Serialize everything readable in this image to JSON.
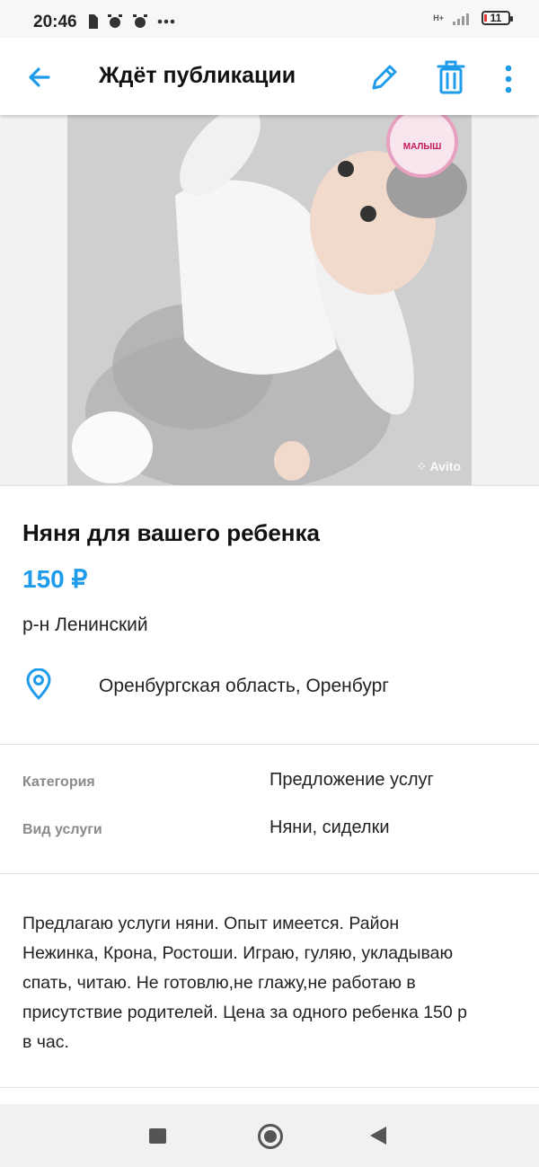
{
  "status_bar": {
    "time": "20:46",
    "network": "H+",
    "battery": "11",
    "icons": [
      "sim-icon",
      "alarm-icon",
      "alarm-icon",
      "more-dots-icon",
      "signal-icon",
      "battery-icon"
    ]
  },
  "app_bar": {
    "title": "Ждёт публикации",
    "icons": [
      "back-arrow-icon",
      "edit-pencil-icon",
      "trash-icon",
      "more-vert-icon"
    ],
    "accent_color": "#1e9bea"
  },
  "photo": {
    "watermark": "Avito",
    "badge_text": "МАЛЫШ"
  },
  "listing": {
    "title": "Няня для вашего ребенка",
    "price": "150 ₽",
    "district": "р-н Ленинский",
    "location": "Оренбургская область, Оренбург"
  },
  "params": [
    {
      "label": "Категория",
      "value": "Предложение услуг"
    },
    {
      "label": "Вид услуги",
      "value": "Няни, сиделки"
    }
  ],
  "description": "Предлагаю услуги няни. Опыт имеется. Район\nНежинка, Крона, Ростоши.  Играю, гуляю, укладываю\nспать, читаю. Не готовлю,не глажу,не работаю в\nприсутствие родителей. Цена за одного ребенка 150 р\nв час.",
  "nav_bar": {
    "buttons": [
      "recents-square-icon",
      "home-circle-icon",
      "back-triangle-icon"
    ]
  }
}
